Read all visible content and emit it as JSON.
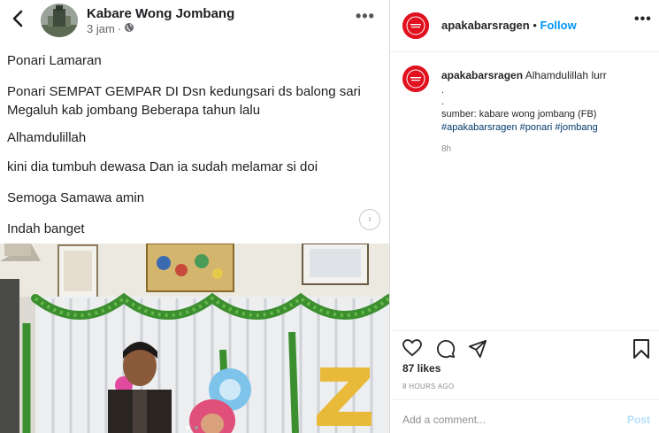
{
  "facebook": {
    "author": "Kabare Wong Jombang",
    "time": "3 jam",
    "separator": "·",
    "lines": [
      "Ponari Lamaran",
      "Ponari SEMPAT GEMPAR DI Dsn kedungsari ds balong sari Megaluh kab jombang Beberapa tahun lalu",
      "Alhamdulillah",
      "kini dia tumbuh dewasa Dan ia sudah melamar si doi",
      "Semoga Samawa amin",
      "Indah banget"
    ],
    "more_label": "•••",
    "see_more_glyph": "›"
  },
  "instagram": {
    "username": "apakabarsragen",
    "dot": "•",
    "follow_label": "Follow",
    "more_label": "•••",
    "caption": {
      "username": "apakabarsragen",
      "text": "Alhamdulillah lurr",
      "dot1": ".",
      "dot2": ".",
      "source": "sumber: kabare wong jombang (FB)",
      "hashtags": "#apakabarsragen #ponari #jombang",
      "time": "8h"
    },
    "likes": "87 likes",
    "time_ago": "8 HOURS AGO",
    "comment_placeholder": "Add a comment...",
    "post_label": "Post",
    "colors": {
      "brand": "#e1111f",
      "link": "#00376b",
      "follow": "#0095f6"
    }
  }
}
